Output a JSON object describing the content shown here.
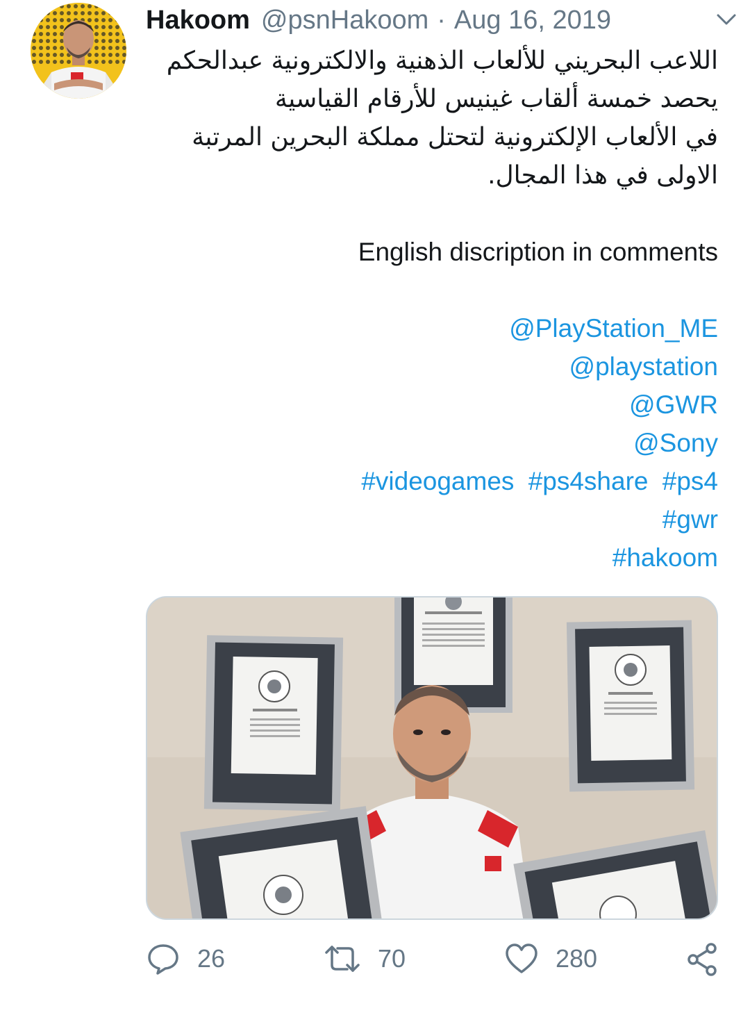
{
  "tweet": {
    "author_name": "Hakoom",
    "author_handle": "@psnHakoom",
    "separator": "·",
    "date": "Aug 16, 2019",
    "arabic_lines": [
      "اللاعب البحريني للألعاب الذهنية والالكترونية عبدالحكم",
      "يحصد خمسة ألقاب غينيس للأرقام القياسية",
      "في الألعاب الإلكترونية لتحتل مملكة البحرين المرتبة",
      "الاولى في هذا المجال."
    ],
    "english_line": "English discription in comments",
    "mentions": [
      "@PlayStation_ME",
      "@playstation",
      "@GWR",
      "@Sony"
    ],
    "hashtags_row1": [
      "#videogames",
      "#ps4share",
      "#ps4"
    ],
    "hashtag_gwr": "#gwr",
    "hashtag_hakoom": "#hakoom"
  },
  "actions": {
    "reply_count": "26",
    "retweet_count": "70",
    "like_count": "280"
  },
  "icons": {
    "menu": "chevron-down-icon",
    "reply": "speech-bubble-icon",
    "retweet": "retweet-arrows-icon",
    "like": "heart-icon",
    "share": "share-nodes-icon"
  },
  "colors": {
    "link": "#1b95e0",
    "secondary_text": "#657786",
    "primary_text": "#14171a",
    "avatar_bg": "#f2c21c"
  }
}
